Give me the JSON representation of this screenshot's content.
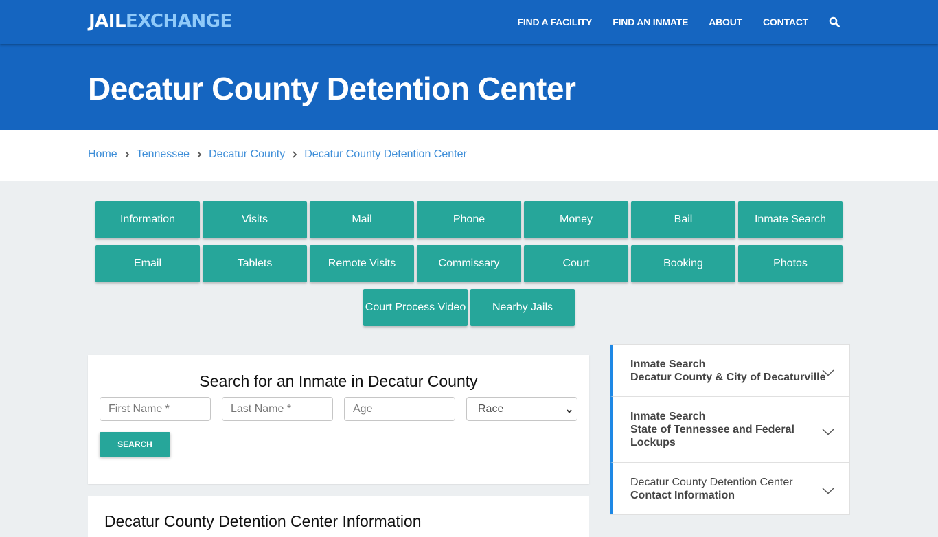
{
  "brand": {
    "part1": "JAIL",
    "part2": "EXCHANGE"
  },
  "nav": {
    "links": [
      "FIND A FACILITY",
      "FIND AN INMATE",
      "ABOUT",
      "CONTACT"
    ],
    "search_icon": "search-icon"
  },
  "page": {
    "title": "Decatur County Detention Center"
  },
  "breadcrumb": [
    "Home",
    "Tennessee",
    "Decatur County",
    "Decatur County Detention Center"
  ],
  "tiles": {
    "row1": [
      "Information",
      "Visits",
      "Mail",
      "Phone",
      "Money",
      "Bail",
      "Inmate Search"
    ],
    "row2": [
      "Email",
      "Tablets",
      "Remote Visits",
      "Commissary",
      "Court",
      "Booking",
      "Photos"
    ],
    "row3": [
      "Court Process Video",
      "Nearby Jails"
    ]
  },
  "search": {
    "heading": "Search for an Inmate in Decatur County",
    "first_name_placeholder": "First Name *",
    "last_name_placeholder": "Last Name *",
    "age_placeholder": "Age",
    "race_selected": "Race",
    "button": "SEARCH"
  },
  "info": {
    "heading": "Decatur County Detention Center Information"
  },
  "sidebar": [
    {
      "line1": "Inmate Search",
      "line2": "Decatur County & City of Decaturville"
    },
    {
      "line1": "Inmate Search",
      "line2": "State of Tennessee and Federal Lockups"
    },
    {
      "line1": "Decatur County Detention Center",
      "line2": "Contact Information"
    }
  ],
  "colors": {
    "primary": "#1565c0",
    "accent": "#26a69a",
    "link": "#3e8ed8",
    "sidebar_border": "#1e88e5"
  }
}
